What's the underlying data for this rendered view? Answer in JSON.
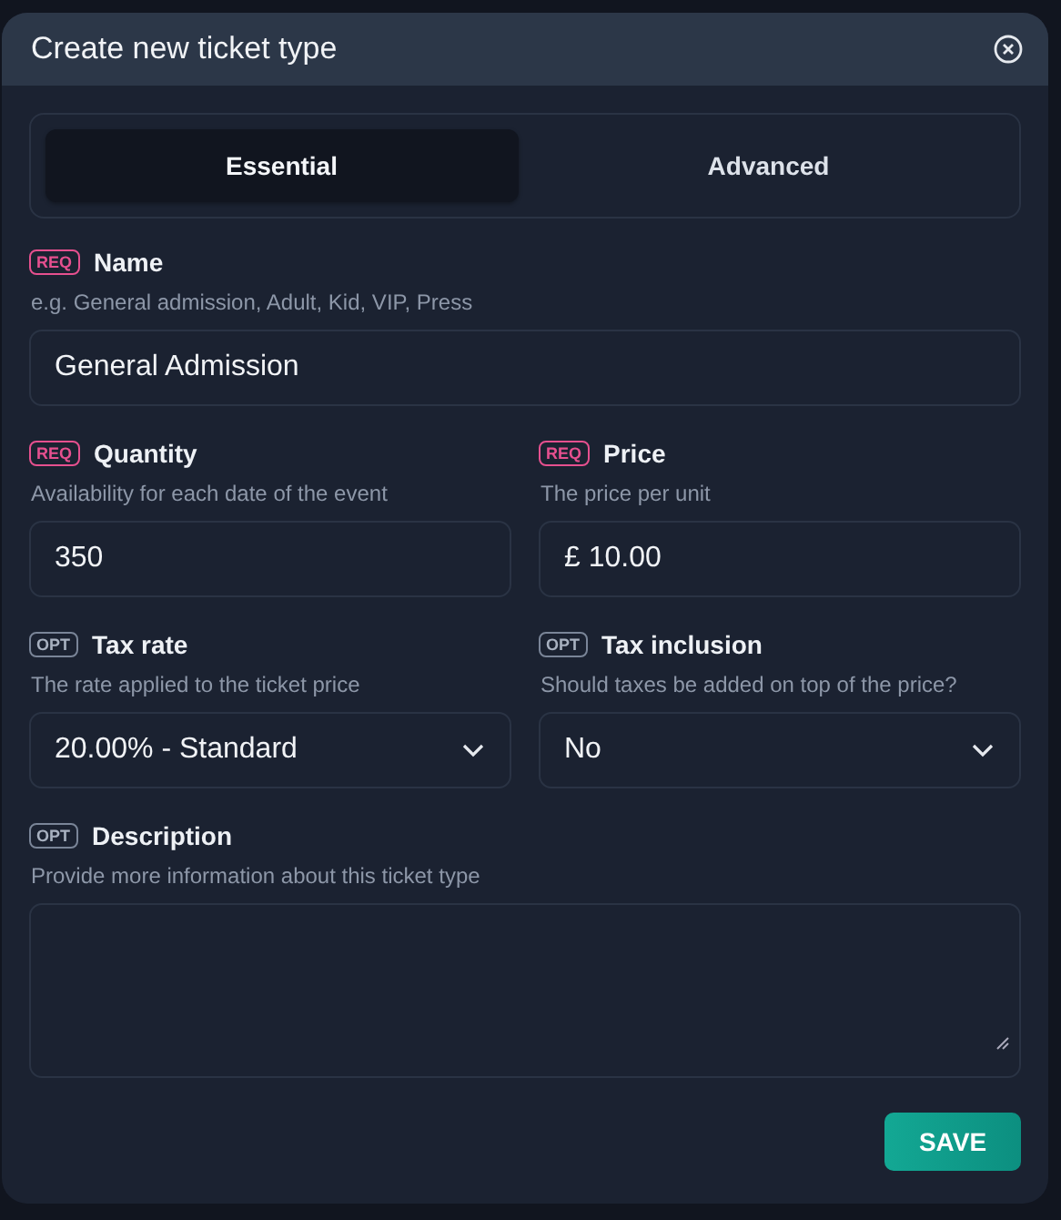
{
  "dialog": {
    "title": "Create new ticket type"
  },
  "tabs": [
    {
      "label": "Essential",
      "selected": true
    },
    {
      "label": "Advanced",
      "selected": false
    }
  ],
  "rows": [
    [
      {
        "badge": {
          "text": "REQ",
          "kind": "required"
        },
        "label": "Name",
        "hint": "e.g. General admission, Adult, Kid, VIP, Press",
        "kind": "text",
        "value": "General Admission"
      }
    ],
    [
      {
        "badge": {
          "text": "REQ",
          "kind": "required"
        },
        "label": "Quantity",
        "hint": "Availability for each date of the event",
        "kind": "text",
        "value": "350"
      },
      {
        "badge": {
          "text": "REQ",
          "kind": "required"
        },
        "label": "Price",
        "hint": "The price per unit",
        "kind": "text",
        "value": "£ 10.00"
      }
    ],
    [
      {
        "badge": {
          "text": "OPT",
          "kind": "optional"
        },
        "label": "Tax rate",
        "hint": "The rate applied to the ticket price",
        "kind": "select",
        "value": "20.00% - Standard"
      },
      {
        "badge": {
          "text": "OPT",
          "kind": "optional"
        },
        "label": "Tax inclusion",
        "hint": "Should taxes be added on top of the price?",
        "kind": "select",
        "value": "No"
      }
    ],
    [
      {
        "badge": {
          "text": "OPT",
          "kind": "optional"
        },
        "label": "Description",
        "hint": "Provide more information about this ticket type",
        "kind": "textarea"
      }
    ]
  ],
  "save_button": "SAVE"
}
